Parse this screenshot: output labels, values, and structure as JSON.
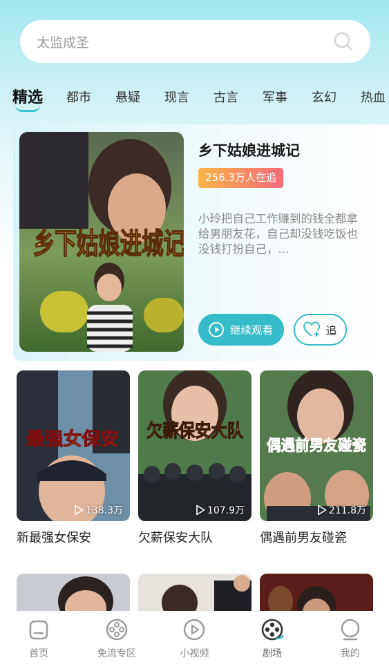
{
  "search": {
    "placeholder": "太监成圣"
  },
  "tabs": [
    {
      "label": "精选",
      "active": true
    },
    {
      "label": "都市"
    },
    {
      "label": "悬疑"
    },
    {
      "label": "现言"
    },
    {
      "label": "古言"
    },
    {
      "label": "军事"
    },
    {
      "label": "玄幻"
    },
    {
      "label": "热血"
    }
  ],
  "featured": {
    "title": "乡下姑娘进城记",
    "poster_title": "乡下姑娘进城记",
    "followers": "256.3万人在追",
    "description": "小玲把自己工作赚到的钱全都拿给男朋友花，自己却没钱吃饭也没钱打扮自己，...",
    "watch_button": "继续观看",
    "follow_button": "追"
  },
  "cards": [
    {
      "title": "新最强女保安",
      "poster_text": "最强女保安",
      "views": "138.3万"
    },
    {
      "title": "欠薪保安大队",
      "poster_text": "欠薪保安大队",
      "views": "107.9万"
    },
    {
      "title": "偶遇前男友碰瓷",
      "poster_text": "偶遇前男友碰瓷",
      "views": "211.8万"
    }
  ],
  "nav": [
    {
      "label": "首页",
      "icon": "home-icon"
    },
    {
      "label": "免流专区",
      "icon": "film-reel-icon"
    },
    {
      "label": "小视频",
      "icon": "play-circle-icon"
    },
    {
      "label": "剧场",
      "icon": "theater-icon",
      "active": true
    },
    {
      "label": "我的",
      "icon": "profile-icon"
    }
  ],
  "colors": {
    "accent": "#35bcc8",
    "badge_start": "#f9b447",
    "badge_end": "#f56b7b"
  }
}
